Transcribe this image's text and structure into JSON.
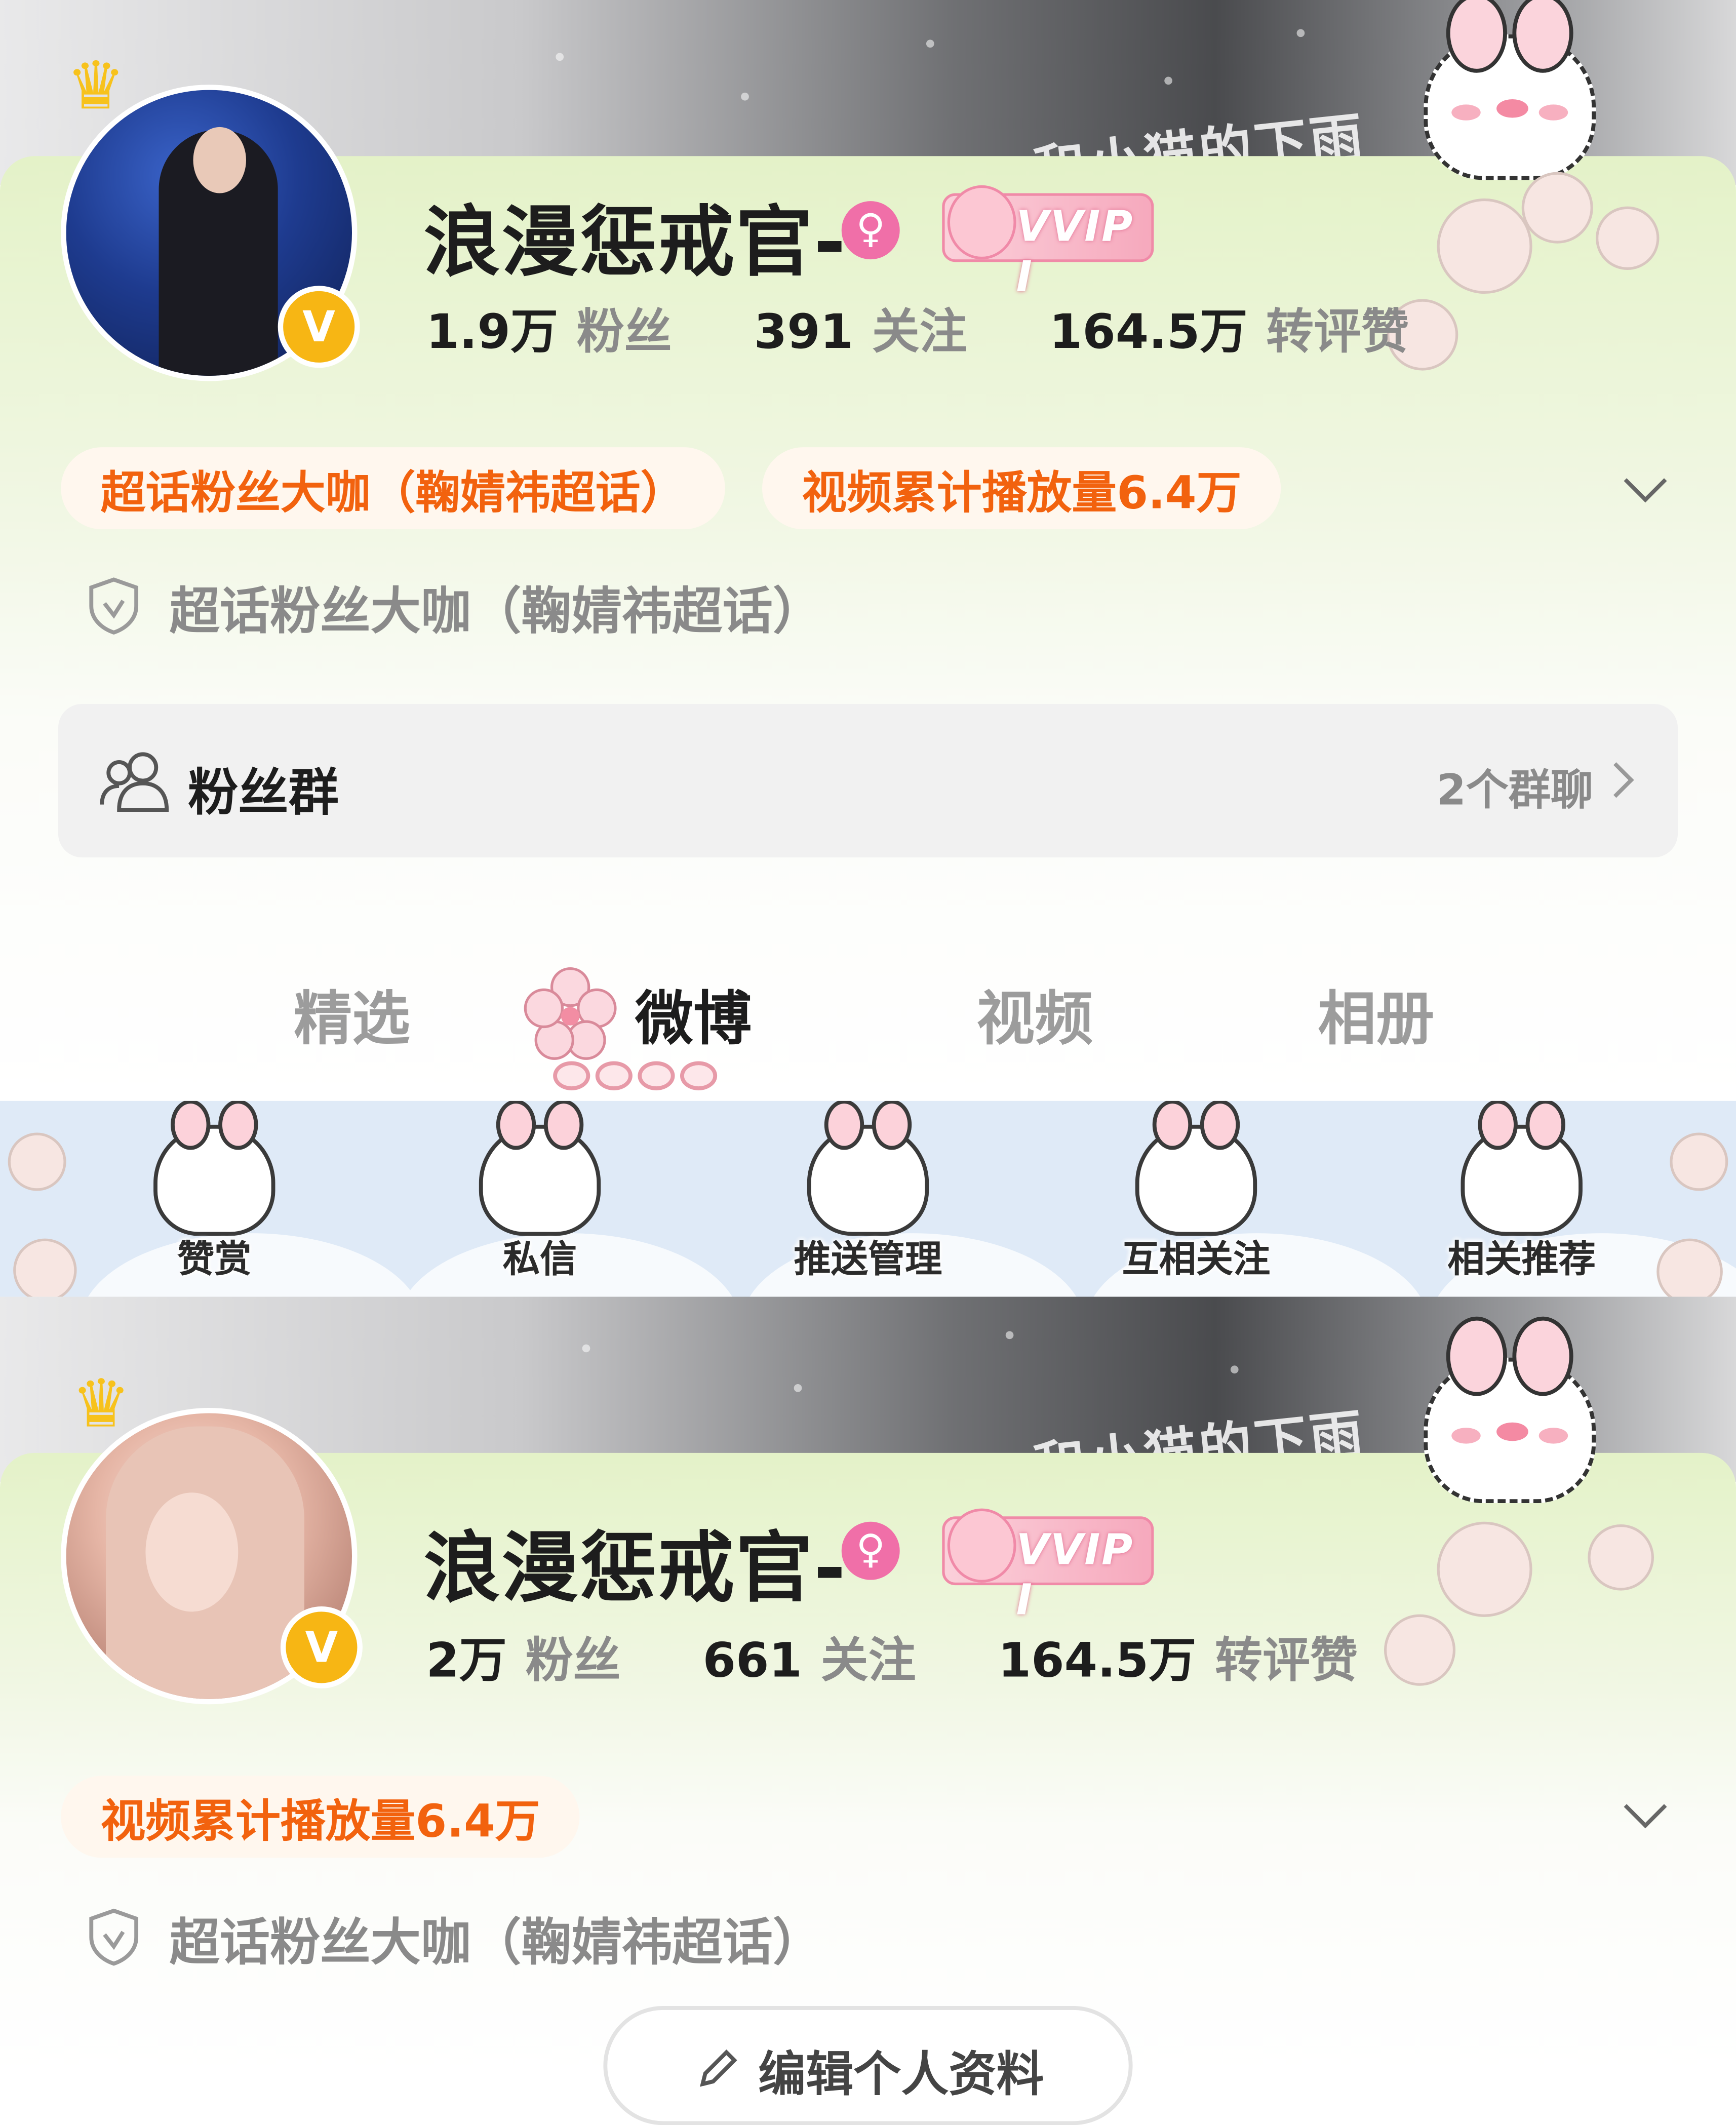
{
  "top_profile": {
    "username": "浪漫惩戒官-",
    "vip_badge": "VVIP I",
    "stats": [
      {
        "value": "1.9万",
        "label": "粉丝"
      },
      {
        "value": "391",
        "label": "关注"
      },
      {
        "value": "164.5万",
        "label": "转评赞"
      }
    ],
    "tags": [
      "超话粉丝大咖（鞠婧祎超话）",
      "视频累计播放量6.4万"
    ],
    "certification": "超话粉丝大咖（鞠婧祎超话）",
    "fan_group": {
      "title": "粉丝群",
      "count": "2个群聊"
    },
    "tabs": [
      "精选",
      "微博",
      "视频",
      "相册"
    ],
    "active_tab": "微博"
  },
  "action_bar": {
    "items": [
      "赞赏",
      "私信",
      "推送管理",
      "互相关注",
      "相关推荐"
    ]
  },
  "bottom_profile": {
    "username": "浪漫惩戒官-",
    "vip_badge": "VVIP I",
    "stats": [
      {
        "value": "2万",
        "label": "粉丝"
      },
      {
        "value": "661",
        "label": "关注"
      },
      {
        "value": "164.5万",
        "label": "转评赞"
      }
    ],
    "tags": [
      "视频累计播放量6.4万"
    ],
    "certification": "超话粉丝大咖（鞠婧祎超话）",
    "edit_button": "编辑个人资料"
  },
  "banner_script": "和小猫的下雨",
  "icons": {
    "gender": "female-icon",
    "verified": "verified-v-icon",
    "crown": "crown-icon",
    "shield": "shield-check-icon",
    "fans": "users-icon",
    "arrow": "chevron-right-icon",
    "expand": "chevron-down-icon",
    "edit": "pencil-icon"
  },
  "colors": {
    "accent_orange": "#f2620e",
    "gender_pink": "#f06fa8",
    "verified_gold": "#f7b614",
    "card_green": "#e4f2c8",
    "action_bar_blue": "#dfeaf7"
  }
}
